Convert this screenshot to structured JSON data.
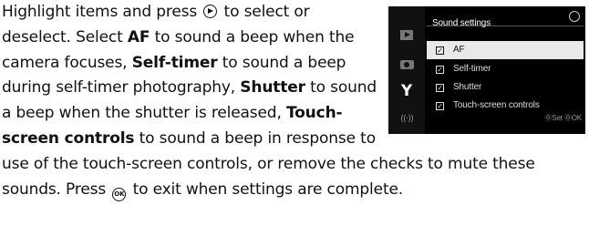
{
  "paragraph": {
    "t1": "Highlight items and press ",
    "t2": " to select or deselect. Select ",
    "af": "AF",
    "t3": " to sound a beep when the camera focuses, ",
    "self_timer": "Self-timer",
    "t4": " to sound a beep during self-timer photography, ",
    "shutter": "Shutter",
    "t5": " to sound a beep when the shut­ter is released, ",
    "touch": "Touch-screen controls",
    "t6": " to sound a beep in response to use of the touch-screen controls, or remove the checks to mute these sounds. Press ",
    "t7": " to exit when settings are complete.",
    "ok_symbol": "OK"
  },
  "camera_screen": {
    "title": "Sound settings",
    "back_symbol": "?",
    "items": [
      {
        "label": "AF",
        "checked": true
      },
      {
        "label": "Self-timer",
        "checked": true
      },
      {
        "label": "Shutter",
        "checked": true
      },
      {
        "label": "Touch-screen controls",
        "checked": true
      }
    ],
    "check_mark": "☑",
    "footer": "ⓄSet  ⓄOK",
    "setup_icon": "Y",
    "wifi_icon": "((·))",
    "colors": {
      "screen_bg": "#000000",
      "highlight": "#e9e9e9"
    }
  }
}
